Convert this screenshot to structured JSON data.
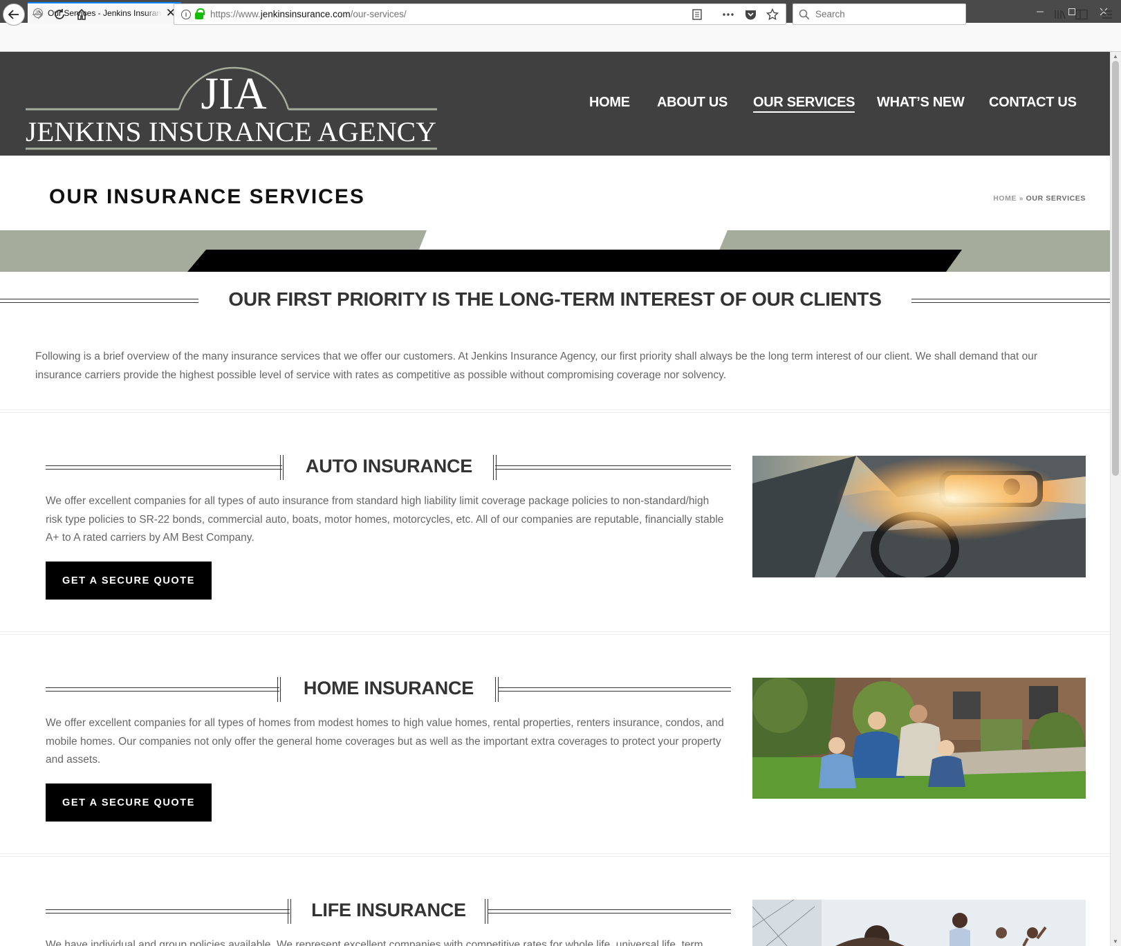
{
  "browser": {
    "tab_title": "Our Services - Jenkins Insurance Agency",
    "favicon_text": "JIA",
    "url_prefix": "https://www.",
    "url_domain": "jenkinsinsurance.com",
    "url_path": "/our-services/",
    "search_placeholder": "Search"
  },
  "site": {
    "logo_initials": "JIA",
    "logo_name": "JENKINS INSURANCE AGENCY",
    "nav": [
      "HOME",
      "ABOUT US",
      "OUR SERVICES",
      "WHAT’S NEW",
      "CONTACT US"
    ],
    "active_nav": "OUR SERVICES"
  },
  "title_band": {
    "title": "OUR INSURANCE SERVICES",
    "breadcrumb_home": "HOME",
    "breadcrumb_sep": "»",
    "breadcrumb_current": "OUR SERVICES"
  },
  "priority": {
    "title": "OUR FIRST PRIORITY IS THE LONG-TERM INTEREST OF OUR CLIENTS",
    "text": "Following is a brief overview of the many insurance services that we offer our customers. At Jenkins Insurance Agency, our first priority shall always be the long term interest of our client. We shall demand that our insurance carriers provide the highest possible level of service with rates as competitive as possible without compromising coverage nor solvency."
  },
  "services": [
    {
      "title": "AUTO INSURANCE",
      "text": "We offer excellent companies for all types of auto insurance from standard high liability limit coverage package policies to non-standard/high risk type policies to SR-22 bonds, commercial auto, boats, motor homes, motorcycles, etc. All of our companies are reputable, financially stable A+ to A rated carriers by AM Best Company.",
      "button": "GET A SECURE QUOTE"
    },
    {
      "title": "HOME INSURANCE",
      "text": "We offer excellent companies for all types of homes from modest homes to high value homes, rental properties, renters insurance, condos, and mobile homes.  Our companies not only offer the general home coverages but as well as the important extra coverages to protect your property and assets.",
      "button": "GET A SECURE QUOTE"
    },
    {
      "title": "LIFE INSURANCE",
      "text": "We have individual and group policies available. We represent excellent companies with competitive rates for whole life, universal life, term"
    }
  ],
  "colors": {
    "header_bg": "#404040",
    "band_sage": "#a6ac9b",
    "band_black": "#000000",
    "button_bg": "#000000",
    "body_text": "#666666"
  },
  "icons": [
    "back-arrow-icon",
    "forward-arrow-icon",
    "reload-icon",
    "home-icon",
    "info-icon",
    "lock-icon",
    "reader-view-icon",
    "page-actions-icon",
    "pocket-icon",
    "bookmark-star-icon",
    "search-icon",
    "library-icon",
    "sidebar-icon",
    "menu-icon"
  ]
}
